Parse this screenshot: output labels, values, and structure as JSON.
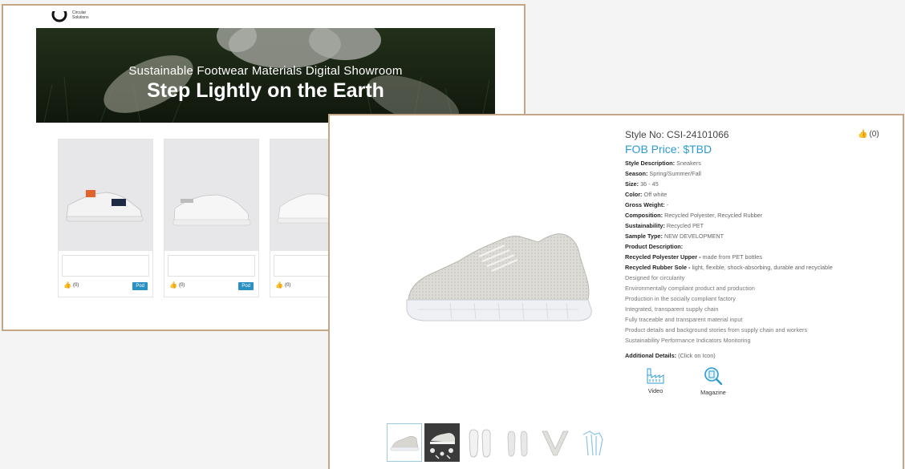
{
  "brand": {
    "line1": "Circular",
    "line2": "Solutions"
  },
  "hero": {
    "subtitle": "Sustainable Footwear Materials Digital Showroom",
    "title": "Step Lightly on the Earth"
  },
  "products": [
    {
      "likes": "(0)",
      "badge": "Pod"
    },
    {
      "likes": "(0)",
      "badge": "Pod"
    },
    {
      "likes": "(0)",
      "badge": ""
    }
  ],
  "detail": {
    "style_no": "Style No: CSI-24101066",
    "likes": "(0)",
    "price": "FOB Price: $TBD",
    "attributes": [
      {
        "label": "Style Description:",
        "value": "Sneakers"
      },
      {
        "label": "Season:",
        "value": "Spring/Summer/Fall"
      },
      {
        "label": "Size:",
        "value": "36 - 45"
      },
      {
        "label": "Color:",
        "value": "Off white"
      },
      {
        "label": "Gross Weight:",
        "value": "-"
      },
      {
        "label": "Composition:",
        "value": "Recycled Polyester, Recycled Rubber"
      },
      {
        "label": "Sustainability:",
        "value": "Recycled PET"
      },
      {
        "label": "Sample Type:",
        "value": "NEW DEVELOPMENT"
      },
      {
        "label": "Product Description:",
        "value": ""
      },
      {
        "label": "Recycled Polyester Upper -",
        "value": "made from PET bottles"
      },
      {
        "label": "Recycled Rubber Sole -",
        "value": "light, flexible, shock-absorbing, durable and recyclable"
      }
    ],
    "description_lines": [
      "Designed for circularity",
      "Environmentally compliant product and production",
      "Production in the socially compliant factory",
      "Integrated, transparent supply chain",
      "Fully traceable and transparent material input",
      "Product details and background stories from supply chain and workers",
      "Sustainability Performance Indicators Monitoring"
    ],
    "additional_label": "Additional Details:",
    "additional_hint": "(Click on Icon)",
    "video_label": "Video",
    "magazine_label": "Magazine"
  },
  "colors": {
    "frame": "#c4a584",
    "accent": "#2d9bd3",
    "badge": "#2a8fc1"
  },
  "icons": [
    "circular-logo-icon",
    "thumbs-up-icon",
    "factory-video-icon",
    "magnifier-magazine-icon"
  ]
}
